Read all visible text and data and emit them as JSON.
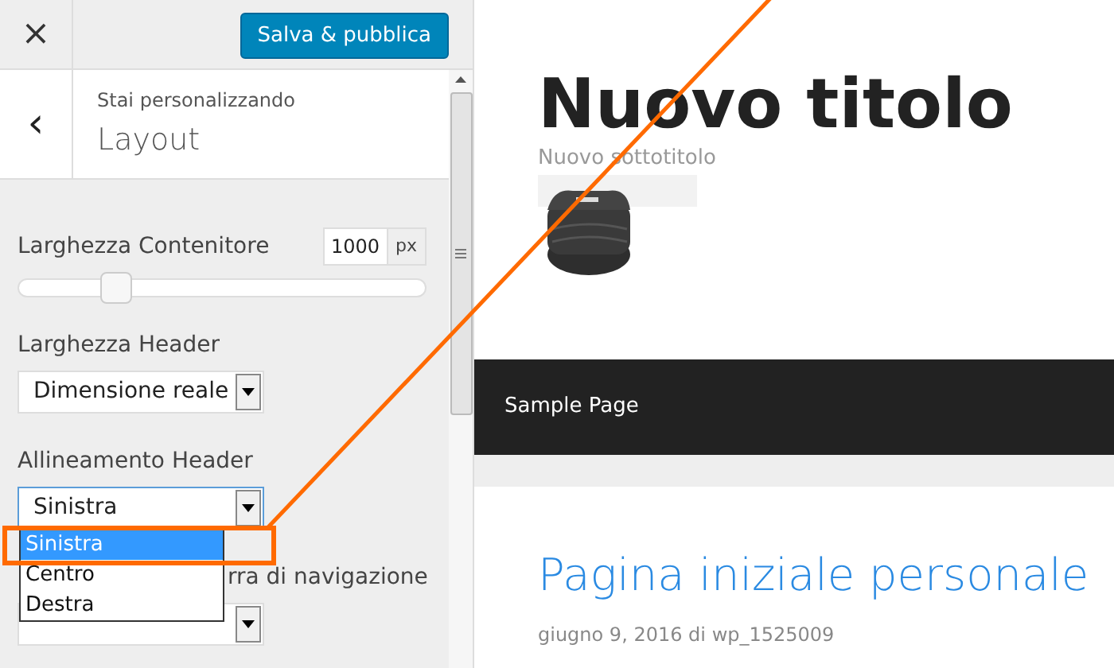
{
  "topbar": {
    "close": "×",
    "publish_button": "Salva & pubblica"
  },
  "section_header": {
    "back": "‹",
    "subtitle": "Stai personalizzando",
    "title": "Layout"
  },
  "controls": [
    {
      "kind": "range",
      "label": "Larghezza Contenitore",
      "value": "1000",
      "unit": "px",
      "level": 0.24
    },
    {
      "kind": "select",
      "label": "Larghezza Header",
      "value": "Dimensione reale",
      "focused": false
    },
    {
      "kind": "select",
      "label": "Allineamento Header",
      "value": "Sinistra",
      "focused": true
    },
    {
      "kind": "select",
      "label": "rra di navigazione",
      "focused": false
    }
  ],
  "dropdown": {
    "options": [
      {
        "label": "Sinistra",
        "selected": true
      },
      {
        "label": "Centro",
        "selected": false
      },
      {
        "label": "Destra",
        "selected": false
      }
    ]
  },
  "preview": {
    "site_title": "Nuovo titolo",
    "tagline": "Nuovo sottotitolo",
    "menu": [
      "Sample Page"
    ],
    "post_title": "Pagina iniziale personale",
    "post_meta": "giugno 9, 2016 di wp_1525009"
  }
}
